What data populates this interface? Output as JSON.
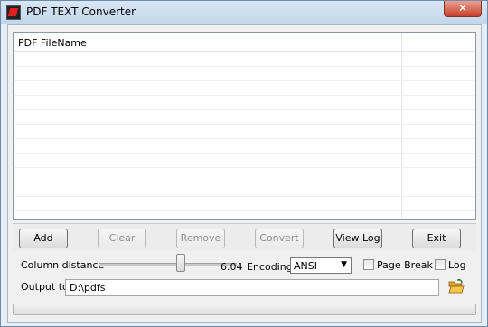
{
  "window": {
    "title": "PDF TEXT Converter",
    "close_glyph": "✕"
  },
  "file_list": {
    "columns": [
      "PDF FileName",
      ""
    ],
    "rows": []
  },
  "buttons": {
    "add": "Add",
    "clear": "Clear",
    "remove": "Remove",
    "convert": "Convert",
    "view_log": "View Log",
    "exit": "Exit"
  },
  "options": {
    "column_distance_label": "Column distance",
    "column_distance_value": "6.04",
    "column_distance_slider_fraction": 0.6,
    "encoding_label": "Encoding",
    "encoding_value": "ANSI",
    "page_break_label": "Page Break",
    "page_break_checked": false,
    "log_label": "Log",
    "log_checked": false
  },
  "output": {
    "label": "Output to",
    "value": "D:\\pdfs"
  },
  "progress": {
    "fraction": 0
  }
}
